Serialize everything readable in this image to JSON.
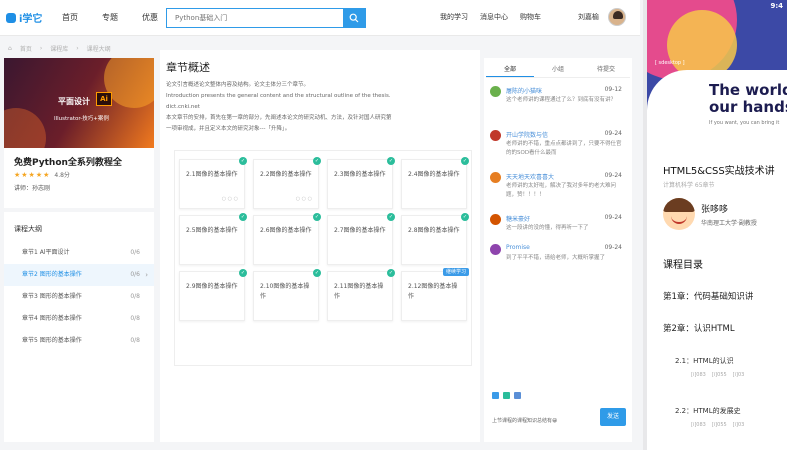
{
  "nav": {
    "logo": "i学它",
    "links": [
      "首页",
      "专题",
      "优惠"
    ],
    "search_placeholder": "Python基础入门",
    "right_links": [
      "我的学习",
      "消息中心",
      "购物车"
    ],
    "username": "刘嘉榆"
  },
  "breadcrumb": [
    "首页",
    "课程库",
    "课程大纲"
  ],
  "course": {
    "cover_title": "平面设计",
    "cover_sub": "Illustrator-技巧+案例",
    "title": "免费Python全系列教程全",
    "stars": "★★★★★",
    "rating": "4.8分",
    "lecturer": "讲师：孙志刚"
  },
  "outline": {
    "heading": "课程大纲",
    "items": [
      {
        "label": "章节1 Al平面设计",
        "count": "0/6"
      },
      {
        "label": "章节2 图形的基本操作",
        "count": "0/6"
      },
      {
        "label": "章节3 图形的基本操作",
        "count": "0/8"
      },
      {
        "label": "章节4 图形的基本操作",
        "count": "0/8"
      },
      {
        "label": "章节5 图形的基本操作",
        "count": "0/8"
      }
    ]
  },
  "chapter": {
    "title": "章节概述",
    "desc": [
      "论文引言概述论文整体内容及结构。论文主体分三个章节。",
      "Introduction presents the general content and the structural outline of the thesis.",
      "dict.cnki.net",
      "本文章节的安排，首先在第一章的部分，先阐述本论文的研究动机、方法，及针对国人研究第",
      "一项审视成，并且定义本文的研究对象---「升降」。"
    ],
    "cards": [
      {
        "label": "2.1图像的基本操作",
        "mini": "○ ○ ○"
      },
      {
        "label": "2.2图像的基本操作",
        "mini": "○ ○ ○"
      },
      {
        "label": "2.3图像的基本操作",
        "mini": ""
      },
      {
        "label": "2.4图像的基本操作",
        "mini": ""
      },
      {
        "label": "2.5图像的基本操作",
        "mini": ""
      },
      {
        "label": "2.6图像的基本操作",
        "mini": ""
      },
      {
        "label": "2.7图像的基本操作",
        "mini": ""
      },
      {
        "label": "2.8图像的基本操作",
        "mini": ""
      },
      {
        "label": "2.9图像的基本操作",
        "mini": ""
      },
      {
        "label": "2.10图像的基本操作",
        "mini": ""
      },
      {
        "label": "2.11图像的基本操作",
        "mini": ""
      },
      {
        "label": "2.12图像的基本操作",
        "mini": "",
        "badge": "继续学习"
      }
    ]
  },
  "comments": {
    "tabs": [
      "全部",
      "小组",
      "待提交"
    ],
    "list": [
      {
        "name": "屠陈的小猫咪",
        "time": "09-12",
        "text": "这个老师讲的课程通过了么？到底有没有讲？",
        "color": "#6ab04c"
      },
      {
        "name": "开山学院数与信",
        "time": "09-24",
        "text": "老师讲的不错，重点点都讲到了，只要不得仕官的的SOD看什么最而",
        "color": "#c0392b"
      },
      {
        "name": "天天地天欢喜喜大",
        "time": "09-24",
        "text": "老师讲的太好啦，解决了我对多年的老大难问题，赞！！！！",
        "color": "#e67e22"
      },
      {
        "name": "糖米豪好",
        "time": "09-24",
        "text": "这一段讲的没的懂，得再听一下了",
        "color": "#d35400"
      },
      {
        "name": "Promise",
        "time": "09-24",
        "text": "到了平平不错，请给老师，大概听掌握了",
        "color": "#8e44ad"
      }
    ],
    "input_placeholder": "上节课程的课程知识总结有😀",
    "send": "发送"
  },
  "phone": {
    "clock": "9:4",
    "banner_title": "The world\nour hands",
    "banner_sub": "If you want, you can bring it",
    "banner_tag": "[ sdesktop ]",
    "course_title": "HTML5&CSS实战技术讲",
    "meta": "计算机科学   65章节",
    "teacher": "张哆哆",
    "org": "华南理工大学·副教授",
    "section_title": "课程目录",
    "chapters": [
      "第1章：代码基础知识讲",
      "第2章：认识HTML"
    ],
    "subs": [
      {
        "label": "2.1：HTML的认识",
        "meta": [
          "[i]083",
          "[i]055",
          "[i]03"
        ]
      },
      {
        "label": "2.2：HTML的发展史",
        "meta": [
          "[i]083",
          "[i]055",
          "[i]03"
        ]
      }
    ]
  }
}
